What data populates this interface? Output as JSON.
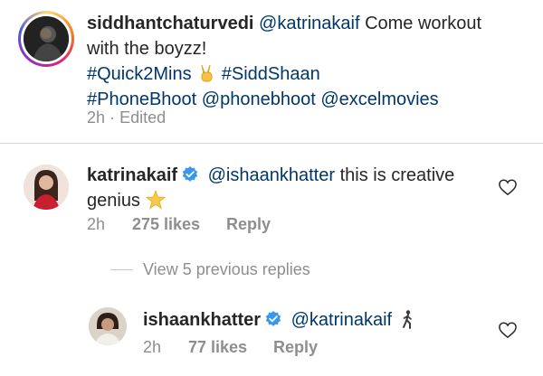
{
  "post": {
    "username": "siddhantchaturvedi",
    "mention": "@katrinakaif",
    "text_part1": "Come workout",
    "text_part2": "with the boyzz!",
    "hashtag1": "#Quick2Mins",
    "emoji1": "victory-hand",
    "hashtag2": "#SiddShaan",
    "hashtag3": "#PhoneBhoot",
    "mention2": "@phonebhoot",
    "mention3": "@excelmovies",
    "time": "2h",
    "separator": "·",
    "edited": "Edited"
  },
  "comments": [
    {
      "username": "katrinakaif",
      "verified": true,
      "mention": "@ishaankhatter",
      "text_part1": "this is creative",
      "text_part2": "genius",
      "emoji": "star",
      "time": "2h",
      "likes": "275 likes",
      "reply_label": "Reply"
    }
  ],
  "view_replies": "View 5 previous replies",
  "reply": {
    "username": "ishaankhatter",
    "verified": true,
    "mention": "@katrinakaif",
    "emoji": "man-walking",
    "time": "2h",
    "likes": "77 likes",
    "reply_label": "Reply"
  },
  "colors": {
    "link": "#00376b",
    "muted": "#8e8e8e",
    "verified": "#3897f0",
    "divider": "#dbdbdb"
  }
}
